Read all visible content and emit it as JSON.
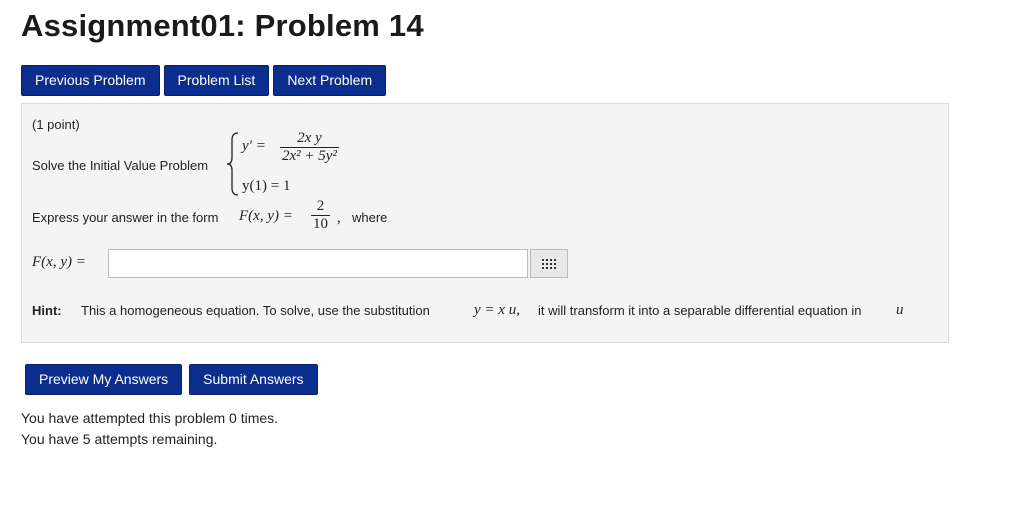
{
  "page": {
    "title": "Assignment01: Problem 14"
  },
  "nav": {
    "previous_label": "Previous Problem",
    "list_label": "Problem List",
    "next_label": "Next Problem"
  },
  "problem": {
    "points": "(1 point)",
    "solve_text": "Solve the Initial Value Problem",
    "ode_lhs": "y′ =",
    "ode_num": "2x y",
    "ode_den": "2x² + 5y²",
    "ic_text": "y(1) = 1",
    "express_text": "Express your answer in the form",
    "form_lhs": "F(x, y) =",
    "form_num": "2",
    "form_den": "10",
    "form_comma": ",",
    "where_text": "where",
    "answer_label": "F(x, y) =",
    "answer_value": "",
    "answer_placeholder": "",
    "palette_icon": "grid-icon",
    "hint_label": "Hint:",
    "hint_text": "This a homogeneous equation. To solve, use the substitution",
    "hint_sub": "y = x u,",
    "hint_text2": "it will transform it into a separable differential equation in",
    "hint_var": "u"
  },
  "actions": {
    "preview_label": "Preview My Answers",
    "submit_label": "Submit Answers"
  },
  "status": {
    "attempts_text": "You have attempted this problem 0 times.",
    "remaining_text": "You have 5 attempts remaining."
  },
  "colors": {
    "button_bg": "#0b2e8e",
    "panel_bg": "#f4f4f4"
  }
}
